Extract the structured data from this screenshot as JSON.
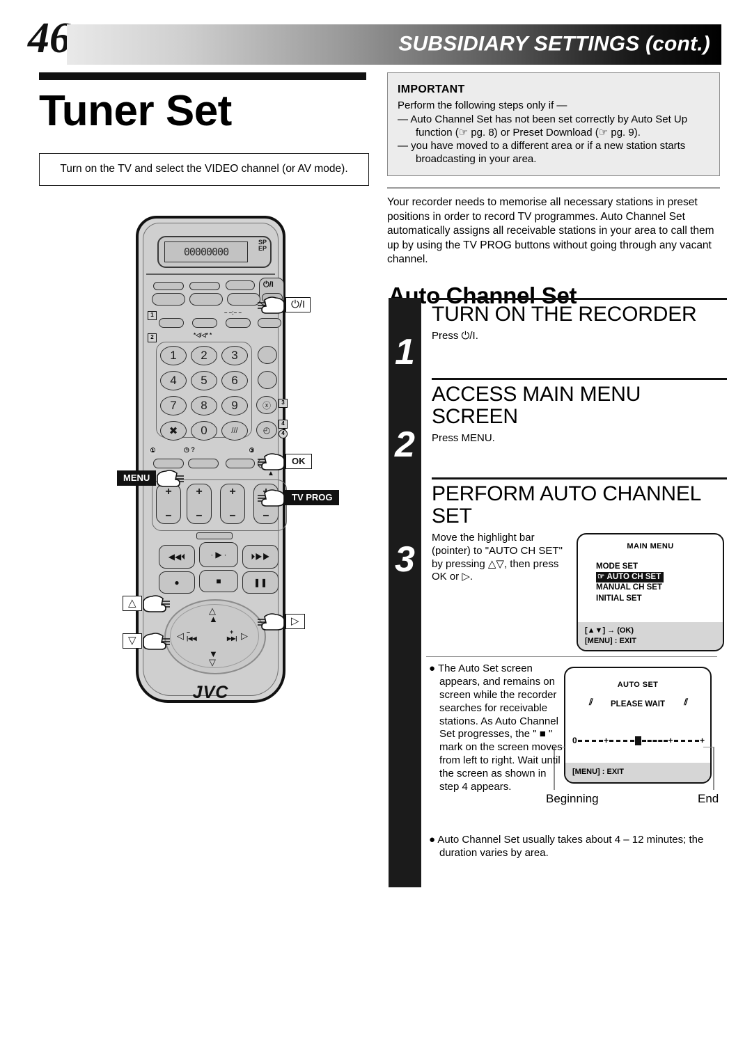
{
  "header": {
    "page_number": "46",
    "running_title": "SUBSIDIARY SETTINGS (cont.)"
  },
  "left": {
    "doc_title": "Tuner Set",
    "tv_note": "Turn on the TV and select the VIDEO channel (or AV mode)."
  },
  "remote": {
    "brand": "JVC",
    "lcd_digits": "00000000",
    "lcd_mode_top": "SP",
    "lcd_mode_bottom": "EP",
    "keys": [
      "1",
      "2",
      "3",
      "4",
      "5",
      "6",
      "7",
      "8",
      "9",
      "0"
    ],
    "key_cancel": "✖",
    "badges": [
      "1",
      "2",
      "3",
      "4"
    ],
    "plus": "+",
    "minus": "–",
    "callouts": {
      "power": "⏻/I",
      "menu": "MENU",
      "ok": "OK",
      "tv_prog": "TV PROG",
      "up": "△",
      "down": "▽",
      "right": "▷"
    }
  },
  "important": {
    "heading": "IMPORTANT",
    "intro": "Perform the following steps only if —",
    "items": [
      "— Auto Channel Set has not been set correctly by Auto Set Up function (☞ pg. 8) or Preset Download (☞ pg. 9).",
      "— you have moved to a different area or if a new station starts broadcasting in your area."
    ]
  },
  "intro_paragraph": "Your recorder needs to memorise all necessary stations in preset positions in order to record TV programmes. Auto Channel Set automatically assigns all receivable stations in your area to call them up by using the TV PROG buttons without going through any vacant channel.",
  "section_title": "Auto Channel Set",
  "steps": [
    {
      "number": "1",
      "heading": "TURN ON THE RECORDER",
      "body": "Press ⏻/I."
    },
    {
      "number": "2",
      "heading": "ACCESS MAIN MENU SCREEN",
      "body": "Press MENU."
    },
    {
      "number": "3",
      "heading": "PERFORM AUTO CHANNEL SET",
      "body": "Move the highlight bar (pointer) to \"AUTO CH SET\" by pressing △▽, then press OK or ▷."
    }
  ],
  "main_menu_screen": {
    "title": "MAIN MENU",
    "items": [
      "MODE SET",
      "AUTO CH SET",
      "MANUAL CH SET",
      "INITIAL SET"
    ],
    "highlighted": "AUTO CH SET",
    "pointer_icon": "☞",
    "footer_line1": "[▲▼] → (OK)",
    "footer_line2": "[MENU] : EXIT"
  },
  "auto_set_screen": {
    "title": "AUTO SET",
    "message": "PLEASE WAIT",
    "progress_start_label": "0",
    "progress_ticks": [
      "+",
      "+",
      "+"
    ],
    "marker": "■",
    "footer": "[MENU] : EXIT",
    "scale_left": "Beginning",
    "scale_right": "End"
  },
  "notes": [
    "The Auto Set screen appears, and remains on screen while the recorder searches for receivable stations. As Auto Channel Set progresses, the \" ■ \" mark on the screen moves from left to right. Wait until the screen as shown in step 4 appears.",
    "Auto Channel Set usually takes about 4 – 12 minutes; the duration varies by area."
  ],
  "colors": {
    "ink": "#111111",
    "panel_gray": "#ececec",
    "screen_footer_gray": "#d6d6d6",
    "remote_body": "#d4d4d4"
  }
}
